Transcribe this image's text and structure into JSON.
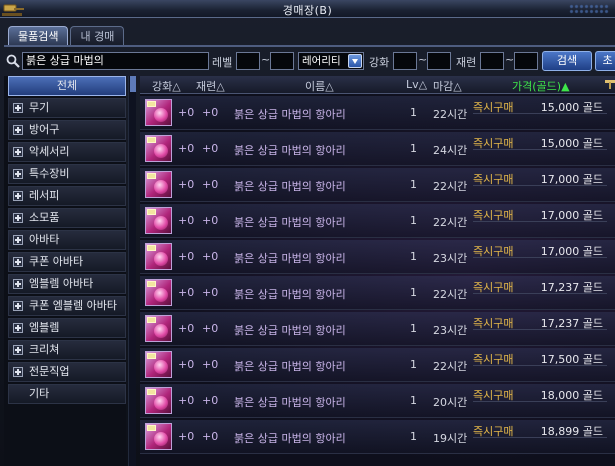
{
  "window": {
    "title": "경매장(B)"
  },
  "tabs": [
    {
      "label": "물품검색",
      "active": true
    },
    {
      "label": "내 경매",
      "active": false
    }
  ],
  "search": {
    "query": "붉은 상급 마법의",
    "level_label": "레벨",
    "level_min": "",
    "level_max": "",
    "rarity_selected": "레어리티",
    "enhance_label": "강화",
    "enhance_min": "",
    "enhance_max": "",
    "refine_label": "재련",
    "refine_min": "",
    "refine_max": "",
    "tilde": "~",
    "search_button": "검색",
    "reset_button": "초"
  },
  "categories": [
    {
      "label": "전체",
      "selected": true,
      "plus": false
    },
    {
      "label": "무기",
      "plus": true
    },
    {
      "label": "방어구",
      "plus": true
    },
    {
      "label": "악세서리",
      "plus": true
    },
    {
      "label": "특수장비",
      "plus": true
    },
    {
      "label": "레서피",
      "plus": true
    },
    {
      "label": "소모품",
      "plus": true
    },
    {
      "label": "아바타",
      "plus": true
    },
    {
      "label": "쿠폰 아바타",
      "plus": true
    },
    {
      "label": "엠블렘 아바타",
      "plus": true
    },
    {
      "label": "쿠폰 엠블렘 아바타",
      "plus": true
    },
    {
      "label": "엠블렘",
      "plus": true
    },
    {
      "label": "크리쳐",
      "plus": true
    },
    {
      "label": "전문직업",
      "plus": true
    },
    {
      "label": "기타",
      "plus": false
    }
  ],
  "columns": {
    "enhance": "강화△",
    "refine": "재련△",
    "name": "이름△",
    "level": "Lv△",
    "deadline": "마감△",
    "price": "가격(골드)▲"
  },
  "rows": [
    {
      "enhance": "+0",
      "refine": "+0",
      "name": "붉은 상급 마법의 항아리",
      "level": "1",
      "time": "22시간",
      "buy": "즉시구매",
      "price": "15,000 골드"
    },
    {
      "enhance": "+0",
      "refine": "+0",
      "name": "붉은 상급 마법의 항아리",
      "level": "1",
      "time": "24시간",
      "buy": "즉시구매",
      "price": "15,000 골드"
    },
    {
      "enhance": "+0",
      "refine": "+0",
      "name": "붉은 상급 마법의 항아리",
      "level": "1",
      "time": "22시간",
      "buy": "즉시구매",
      "price": "17,000 골드"
    },
    {
      "enhance": "+0",
      "refine": "+0",
      "name": "붉은 상급 마법의 항아리",
      "level": "1",
      "time": "22시간",
      "buy": "즉시구매",
      "price": "17,000 골드"
    },
    {
      "enhance": "+0",
      "refine": "+0",
      "name": "붉은 상급 마법의 항아리",
      "level": "1",
      "time": "23시간",
      "buy": "즉시구매",
      "price": "17,000 골드"
    },
    {
      "enhance": "+0",
      "refine": "+0",
      "name": "붉은 상급 마법의 항아리",
      "level": "1",
      "time": "22시간",
      "buy": "즉시구매",
      "price": "17,237 골드"
    },
    {
      "enhance": "+0",
      "refine": "+0",
      "name": "붉은 상급 마법의 항아리",
      "level": "1",
      "time": "23시간",
      "buy": "즉시구매",
      "price": "17,237 골드"
    },
    {
      "enhance": "+0",
      "refine": "+0",
      "name": "붉은 상급 마법의 항아리",
      "level": "1",
      "time": "22시간",
      "buy": "즉시구매",
      "price": "17,500 골드"
    },
    {
      "enhance": "+0",
      "refine": "+0",
      "name": "붉은 상급 마법의 항아리",
      "level": "1",
      "time": "20시간",
      "buy": "즉시구매",
      "price": "18,000 골드"
    },
    {
      "enhance": "+0",
      "refine": "+0",
      "name": "붉은 상급 마법의 항아리",
      "level": "1",
      "time": "19시간",
      "buy": "즉시구매",
      "price": "18,899 골드"
    }
  ],
  "icons": {
    "logo": "auction-hammer-icon",
    "search": "magnifier-icon",
    "dropdown": "chevron-down-icon",
    "item": "potion-jar-icon"
  },
  "colors": {
    "price_header": "#3ee64a",
    "buy_text": "#e4b84a",
    "item_name": "#c8b4e8",
    "accent": "#4b77c8"
  }
}
